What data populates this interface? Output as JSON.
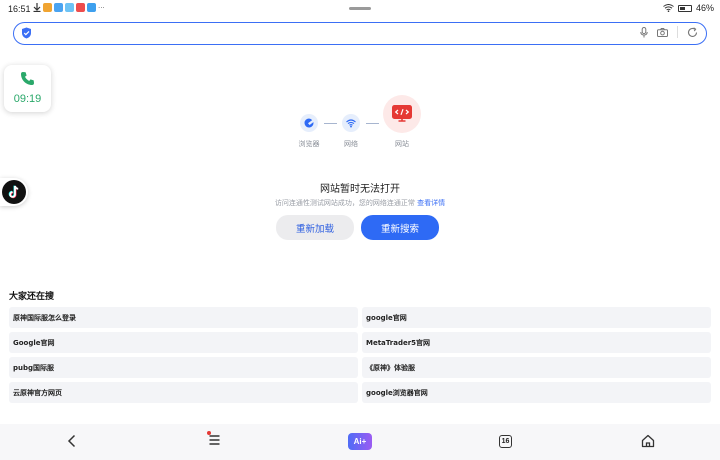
{
  "status": {
    "time": "16:51",
    "battery": "46%",
    "notification_icons": [
      "download-icon",
      "app-icon",
      "app-icon",
      "app-icon",
      "app-icon",
      "app-icon"
    ],
    "more": "···"
  },
  "search": {
    "value": "",
    "placeholder": ""
  },
  "call_widget": {
    "time": "09:19"
  },
  "diagram": {
    "browser_label": "浏览器",
    "network_label": "网络",
    "website_label": "网站"
  },
  "error": {
    "title": "网站暂时无法打开",
    "subtitle": "访问连通性测试网站成功，您的网络连通正常",
    "details_link": "查看详情",
    "reload_label": "重新加载",
    "search_label": "重新搜索"
  },
  "trending": {
    "title": "大家还在搜",
    "items": [
      "原神国际服怎么登录",
      "google官网",
      "Google官网",
      "MetaTrader5官网",
      "pubg国际服",
      "《原神》体验服",
      "云原神官方网页",
      "google浏览器官网"
    ]
  },
  "bottom": {
    "ai_label": "Ai+",
    "tab_count": "16"
  },
  "colors": {
    "accent": "#2e6af5",
    "error_red": "#e53935",
    "call_green": "#2aa86a"
  }
}
